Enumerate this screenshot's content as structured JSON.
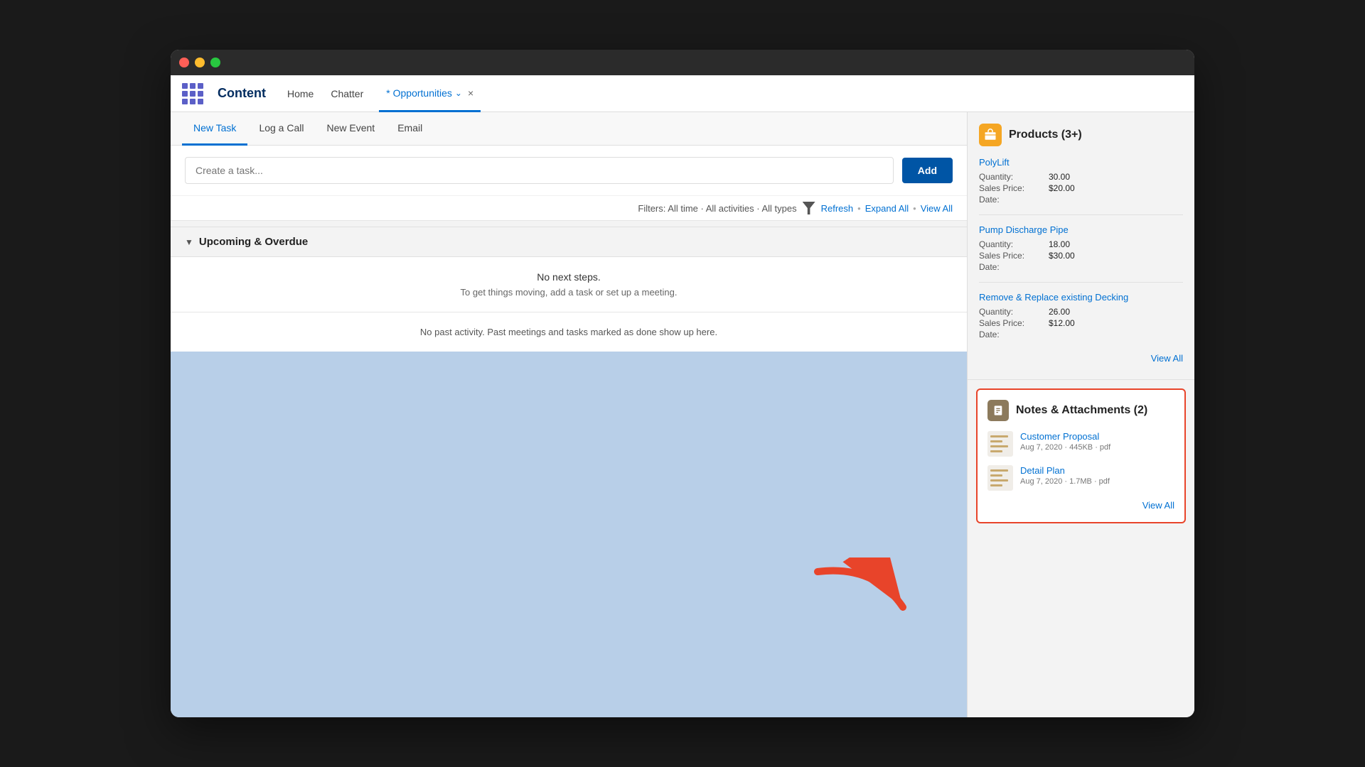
{
  "window": {
    "title": "Opportunities"
  },
  "navbar": {
    "app_name": "Content",
    "links": [
      "Home",
      "Chatter"
    ],
    "active_tab": "* Opportunities",
    "tab_close": "×"
  },
  "activity": {
    "tabs": [
      "New Task",
      "Log a Call",
      "New Event",
      "Email"
    ],
    "active_tab": "New Task",
    "task_placeholder": "Create a task...",
    "add_button": "Add",
    "filters_label": "Filters: All time · All activities · All types",
    "refresh_link": "Refresh",
    "expand_all_link": "Expand All",
    "view_all_link": "View All"
  },
  "upcoming": {
    "header": "Upcoming & Overdue",
    "empty_title": "No next steps.",
    "empty_subtitle": "To get things moving, add a task or set up a meeting.",
    "past_activity": "No past activity. Past meetings and tasks marked as done show up here."
  },
  "products": {
    "title": "Products (3+)",
    "icon": "📦",
    "items": [
      {
        "name": "PolyLift",
        "quantity_label": "Quantity:",
        "quantity": "30.00",
        "price_label": "Sales Price:",
        "price": "$20.00",
        "date_label": "Date:",
        "date": ""
      },
      {
        "name": "Pump Discharge Pipe",
        "quantity_label": "Quantity:",
        "quantity": "18.00",
        "price_label": "Sales Price:",
        "price": "$30.00",
        "date_label": "Date:",
        "date": ""
      },
      {
        "name": "Remove & Replace existing Decking",
        "quantity_label": "Quantity:",
        "quantity": "26.00",
        "price_label": "Sales Price:",
        "price": "$12.00",
        "date_label": "Date:",
        "date": ""
      }
    ],
    "view_all": "View All"
  },
  "notes": {
    "title": "Notes & Attachments (2)",
    "icon": "📋",
    "attachments": [
      {
        "name": "Customer Proposal",
        "meta": "Aug 7, 2020 · 445KB · pdf"
      },
      {
        "name": "Detail Plan",
        "meta": "Aug 7, 2020 · 1.7MB · pdf"
      }
    ],
    "view_all": "View All"
  }
}
